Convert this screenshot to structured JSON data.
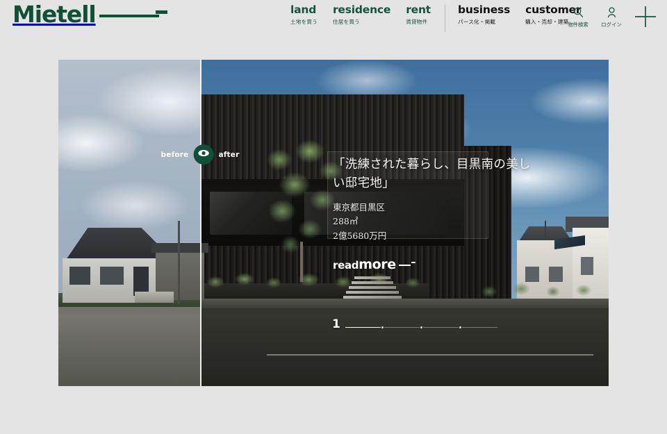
{
  "brand": {
    "logo_text": "Mietell",
    "accent_green": "#0f5037",
    "page_bg": "#e4e4e4"
  },
  "nav": {
    "primary": [
      {
        "en": "land",
        "jp": "土地を買う",
        "color": "#14543c"
      },
      {
        "en": "residence",
        "jp": "住居を買う",
        "color": "#14543c"
      },
      {
        "en": "rent",
        "jp": "賃貸物件",
        "color": "#14543c"
      }
    ],
    "secondary": [
      {
        "en": "business",
        "jp": "パース化・掲載",
        "color": "#141414"
      },
      {
        "en": "customer",
        "jp": "購入・売却・建築",
        "color": "#141414"
      }
    ]
  },
  "utils": [
    {
      "icon": "search-icon",
      "label": "物件検索"
    },
    {
      "icon": "user-icon",
      "label": "ログイン"
    }
  ],
  "menu": {
    "icon": "plus-icon",
    "label": ""
  },
  "hero": {
    "compare": {
      "before_label": "before",
      "after_label": "after",
      "handle_icon": "eye-icon",
      "handle_color": "#0f5037",
      "divider_position_pct": 26
    },
    "title": "「洗練された暮らし、目黒南の美しい邸宅地」",
    "meta": {
      "location": "東京都目黒区",
      "area": "288㎡",
      "price": "2億5680万円"
    },
    "cta": {
      "small": "read",
      "large": "more",
      "icon": "arrow-right-icon"
    },
    "pager": {
      "current": "1",
      "total_segments": 4,
      "active_index": 0
    }
  },
  "below_fold": {
    "heading": "",
    "subheading": ""
  }
}
